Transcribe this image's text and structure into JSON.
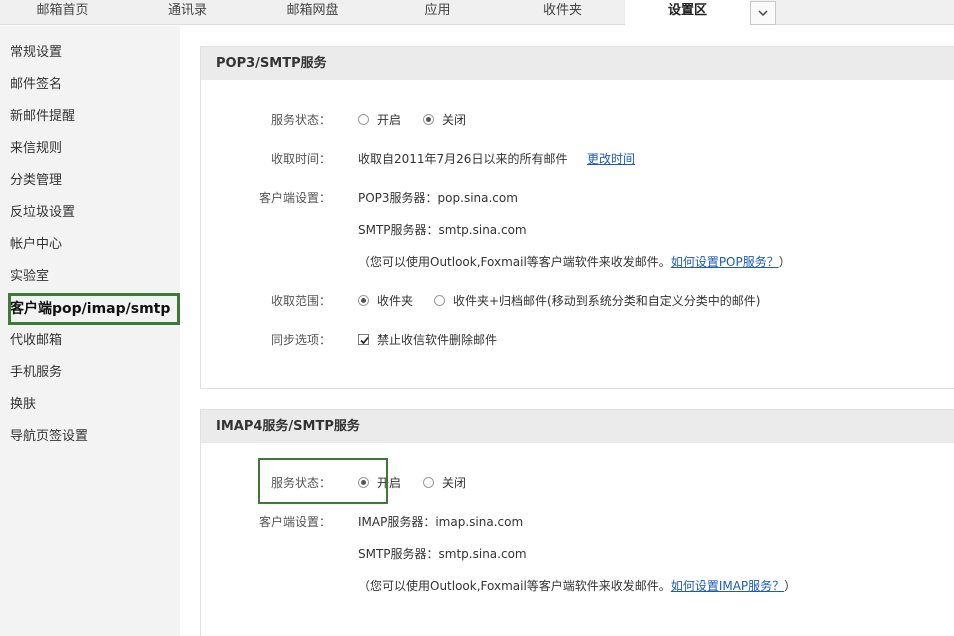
{
  "top_nav": {
    "tabs": [
      {
        "label": "邮箱首页"
      },
      {
        "label": "通讯录"
      },
      {
        "label": "邮箱网盘"
      },
      {
        "label": "应用"
      },
      {
        "label": "收件夹"
      },
      {
        "label": "设置区"
      }
    ],
    "active_tab": "设置区",
    "more_icon": "chevron-down-icon"
  },
  "sidebar": {
    "items": [
      {
        "label": "常规设置"
      },
      {
        "label": "邮件签名"
      },
      {
        "label": "新邮件提醒"
      },
      {
        "label": "来信规则"
      },
      {
        "label": "分类管理"
      },
      {
        "label": "反垃圾设置"
      },
      {
        "label": "帐户中心"
      },
      {
        "label": "实验室"
      },
      {
        "label": "客户端pop/imap/smtp"
      },
      {
        "label": "代收邮箱"
      },
      {
        "label": "手机服务"
      },
      {
        "label": "换肤"
      },
      {
        "label": "导航页签设置"
      }
    ],
    "active_item": "客户端pop/imap/smtp"
  },
  "pop3": {
    "title": "POP3/SMTP服务",
    "status_label": "服务状态：",
    "status_options": [
      {
        "label": "开启",
        "checked": false
      },
      {
        "label": "关闭",
        "checked": true
      }
    ],
    "fetch_time_label": "收取时间：",
    "fetch_time_value": "收取自2011年7月26日以来的所有邮件",
    "change_time_link": "更改时间",
    "client_label": "客户端设置：",
    "pop3_server": "POP3服务器：pop.sina.com",
    "smtp_server": "SMTP服务器：smtp.sina.com",
    "hint": "（您可以使用Outlook,Foxmail等客户端软件来收发邮件。",
    "hint_link": "如何设置POP服务？",
    "hint_close": "）",
    "range_label": "收取范围：",
    "range_options": [
      {
        "label": "收件夹",
        "checked": true
      },
      {
        "label": "收件夹+归档邮件(移动到系统分类和自定义分类中的邮件)",
        "checked": false
      }
    ],
    "sync_label": "同步选项：",
    "sync_option": {
      "label": "禁止收信软件删除邮件",
      "checked": true
    }
  },
  "imap": {
    "title": "IMAP4服务/SMTP服务",
    "status_label": "服务状态：",
    "status_options": [
      {
        "label": "开启",
        "checked": true
      },
      {
        "label": "关闭",
        "checked": false
      }
    ],
    "client_label": "客户端设置：",
    "imap_server": "IMAP服务器：imap.sina.com",
    "smtp_server": "SMTP服务器：smtp.sina.com",
    "hint": "（您可以使用Outlook,Foxmail等客户端软件来收发邮件。",
    "hint_link": "如何设置IMAP服务？",
    "hint_close": "）"
  },
  "colors": {
    "highlight": "#3c7a35",
    "link": "#1d5bb8",
    "sidebar_bg": "#f3f3f3",
    "panel_header_bg": "#ebebeb"
  }
}
